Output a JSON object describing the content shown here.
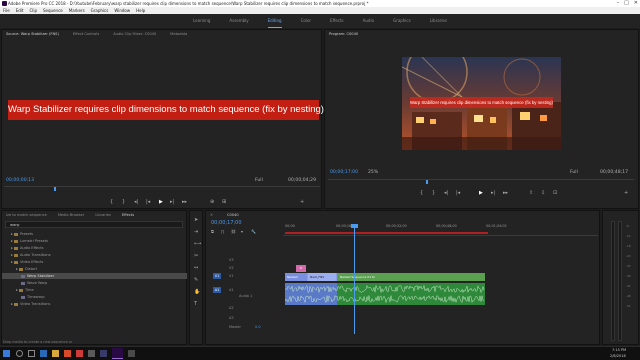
{
  "window": {
    "title": "Adobe Premiere Pro CC 2018 - D:\\Youtube\\February\\warp stabilizer requires clip dimensions to match sequence\\Warp Stabilizer requires clip dimensions to match sequence.prproj *"
  },
  "menu": [
    "File",
    "Edit",
    "Clip",
    "Sequence",
    "Markers",
    "Graphics",
    "Window",
    "Help"
  ],
  "workspaces": [
    "Learning",
    "Assembly",
    "Editing",
    "Color",
    "Effects",
    "Audio",
    "Graphics",
    "Libraries"
  ],
  "workspace_active": "Editing",
  "source_monitor": {
    "tabs": [
      "Source: Warp Stabilizer (FNS)",
      "Effect Controls",
      "Audio Clip Mixer: C0040",
      "Metadata"
    ],
    "overlay_text": "Warp Stabilizer requires clip dimensions to match sequence (fix by nesting)",
    "timecode_left": "00;00;00;13",
    "fit": "Full",
    "timecode_right": "00;00;04;29"
  },
  "program_monitor": {
    "tab": "Program: C0040",
    "overlay_text": "Warp Stabilizer requires clip dimensions to match sequence (fix by nesting)",
    "timecode_left": "00;00;17;00",
    "zoom": "25%",
    "fit": "Full",
    "timecode_right": "00;00;48;17"
  },
  "project_panel": {
    "tabs": [
      "ize to match sequence",
      "Media Browser",
      "Libraries",
      "Effects"
    ],
    "search_value": "warp",
    "items": [
      {
        "label": "Presets",
        "level": 1
      },
      {
        "label": "Lumetri Presets",
        "level": 1
      },
      {
        "label": "Audio Effects",
        "level": 1
      },
      {
        "label": "Audio Transitions",
        "level": 1
      },
      {
        "label": "Video Effects",
        "level": 1
      },
      {
        "label": "Distort",
        "level": 2
      },
      {
        "label": "Warp Stabilizer",
        "level": 3
      },
      {
        "label": "Wave Warp",
        "level": 3
      },
      {
        "label": "Time",
        "level": 2
      },
      {
        "label": "Timewarp",
        "level": 3
      },
      {
        "label": "Video Transitions",
        "level": 1
      }
    ],
    "selected_index": 6
  },
  "timeline": {
    "tab": "C0040",
    "timecode": "00;00;17;00",
    "ruler": [
      "00;00",
      "00;00;16;00",
      "00;00;32;00",
      "00;00;48;00",
      "00;01;04;02"
    ],
    "video_tracks": [
      "V3",
      "V2",
      "V1"
    ],
    "audio_tracks": [
      "A1",
      "A2",
      "A3"
    ],
    "v1_label": "V1",
    "a1_label": "A1",
    "audio_1_label": "Audio 1",
    "master_label": "Master",
    "master_value": "0.0",
    "clips": {
      "adjustment": "fx",
      "v1_a": "Nested",
      "v1_b": "Nest_FNS",
      "v1_c": "Nested Sequence 01 fx"
    }
  },
  "status_bar": {
    "text": "Drop media to create a new sequence or"
  },
  "taskbar": {
    "time": "7:15 PM",
    "date": "2/8/2018"
  },
  "colors": {
    "accent": "#4a9af0",
    "banner_red": "#c21f12",
    "playhead": "#4a9af0"
  }
}
